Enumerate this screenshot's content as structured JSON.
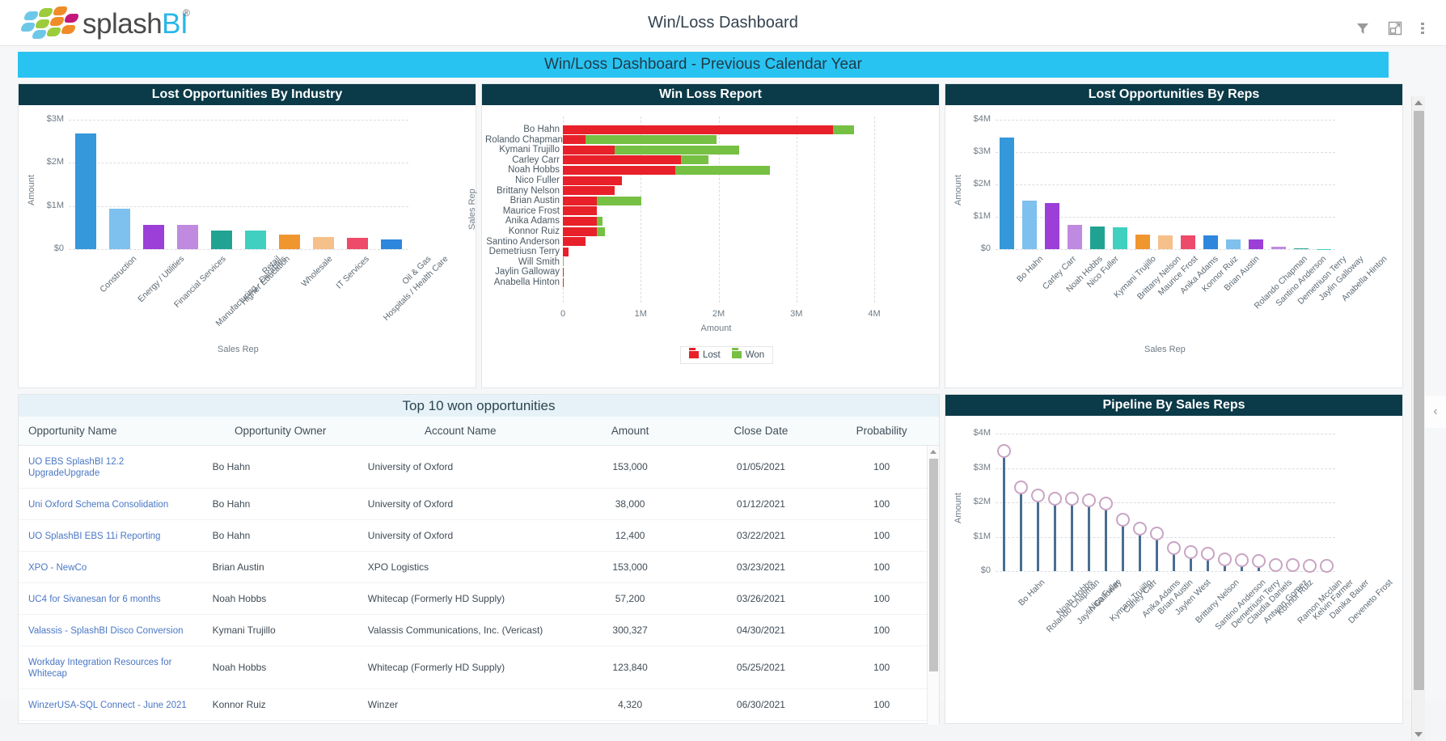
{
  "app": {
    "brand_main": "splash",
    "brand_accent": "BI",
    "brand_reg": "®",
    "title": "Win/Loss Dashboard",
    "header_icons": [
      "filter-icon",
      "expand-icon",
      "more-vertical-icon"
    ]
  },
  "banner": {
    "text": "Win/Loss Dashboard - Previous Calendar Year",
    "color": "#29c3f2"
  },
  "colors": {
    "panel_header": "#0b3a48",
    "lost": "#e8202a",
    "won": "#76c043",
    "link": "#4a77c4",
    "lolli_ring": "#c9a5c4",
    "lolli_stem": "#4a6e92"
  },
  "panels": {
    "lost_by_industry": "Lost Opportunities By Industry",
    "win_loss_report": "Win Loss Report",
    "lost_by_reps": "Lost Opportunities By Reps",
    "top10": "Top 10 won opportunities",
    "pipeline": "Pipeline By Sales Reps"
  },
  "chart_data": [
    {
      "id": "lost_by_industry",
      "type": "bar",
      "title": "Lost Opportunities By Industry",
      "xlabel": "Sales Rep",
      "ylabel": "Amount",
      "ylim": [
        0,
        3000000
      ],
      "yticks": [
        "$0",
        "$1M",
        "$2M",
        "$3M"
      ],
      "ytick_values": [
        0,
        1000000,
        2000000,
        3000000
      ],
      "grid": true,
      "categories": [
        "Construction",
        "Energy / Utilities",
        "Financial Services",
        "Manufacturing - Durables",
        "Higher Education",
        "Retail",
        "Wholesale",
        "IT Services",
        "Hospitals / Health Care",
        "Oil & Gas"
      ],
      "values": [
        2680000,
        930000,
        570000,
        555000,
        440000,
        440000,
        330000,
        290000,
        255000,
        225000
      ],
      "bar_colors": [
        "#3498db",
        "#7ec0ee",
        "#9b3fd8",
        "#bf8ae0",
        "#21a392",
        "#3fd0c0",
        "#f0962e",
        "#f6c08a",
        "#ee4a6a",
        "#2f86dd"
      ]
    },
    {
      "id": "win_loss_report",
      "type": "bar",
      "orientation": "horizontal",
      "stacked": true,
      "title": "Win Loss Report",
      "xlabel": "Amount",
      "ylabel": "Sales Rep",
      "xlim": [
        0,
        4000000
      ],
      "xticks": [
        "0",
        "1M",
        "2M",
        "3M",
        "4M"
      ],
      "xtick_values": [
        0,
        1000000,
        2000000,
        3000000,
        4000000
      ],
      "grid": true,
      "legend": [
        {
          "label": "Lost",
          "color": "#e8202a"
        },
        {
          "label": "Won",
          "color": "#76c043"
        }
      ],
      "categories": [
        "Bo Hahn",
        "Rolando Chapman",
        "Kymani Trujillo",
        "Carley Carr",
        "Noah Hobbs",
        "Nico Fuller",
        "Brittany Nelson",
        "Brian Austin",
        "Maurice Frost",
        "Anika Adams",
        "Konnor Ruiz",
        "Santino Anderson",
        "Demetriusn Terry",
        "Will Smith",
        "Jaylin Galloway",
        "Anabella Hinton"
      ],
      "series": [
        {
          "name": "Lost",
          "values": [
            3470000,
            290000,
            670000,
            1520000,
            1440000,
            760000,
            670000,
            440000,
            440000,
            440000,
            440000,
            290000,
            70000,
            0,
            10000,
            10000
          ]
        },
        {
          "name": "Won",
          "values": [
            270000,
            1680000,
            1600000,
            350000,
            1220000,
            0,
            0,
            570000,
            0,
            70000,
            100000,
            0,
            0,
            12000,
            0,
            0
          ]
        }
      ]
    },
    {
      "id": "lost_by_reps",
      "type": "bar",
      "title": "Lost Opportunities By Reps",
      "xlabel": "Sales Rep",
      "ylabel": "Amount",
      "ylim": [
        0,
        4000000
      ],
      "yticks": [
        "$0",
        "$1M",
        "$2M",
        "$3M",
        "$4M"
      ],
      "ytick_values": [
        0,
        1000000,
        2000000,
        3000000,
        4000000
      ],
      "grid": true,
      "categories": [
        "Bo Hahn",
        "Carley Carr",
        "Noah Hobbs",
        "Nico Fuller",
        "Kymani Trujillo",
        "Brittany Nelson",
        "Maurice Frost",
        "Anika Adams",
        "Konnor Ruiz",
        "Brian Austin",
        "Rolando Chapman",
        "Santino Anderson",
        "Demetriusn Terry",
        "Jaylin Galloway",
        "Anabella Hinton"
      ],
      "values": [
        3460000,
        1500000,
        1430000,
        760000,
        690000,
        670000,
        440000,
        430000,
        430000,
        420000,
        290000,
        290000,
        80000,
        15000,
        12000
      ],
      "bar_colors": [
        "#3498db",
        "#7ec0ee",
        "#9b3fd8",
        "#bf8ae0",
        "#21a392",
        "#3fd0c0",
        "#f0962e",
        "#f6c08a",
        "#ee4a6a",
        "#2f86dd",
        "#7ec0ee",
        "#9b3fd8",
        "#bf8ae0",
        "#21a392",
        "#3fd0c0"
      ]
    },
    {
      "id": "pipeline_by_sales_reps",
      "type": "scatter",
      "variant": "lollipop",
      "title": "Pipeline By Sales Reps",
      "xlabel": "",
      "ylabel": "Amount",
      "ylim": [
        0,
        4000000
      ],
      "yticks": [
        "$0",
        "$1M",
        "$2M",
        "$3M",
        "$4M"
      ],
      "ytick_values": [
        0,
        1000000,
        2000000,
        3000000,
        4000000
      ],
      "grid": true,
      "categories": [
        "Bo Hahn",
        "Rolando Chapman",
        "Noah Hobbs",
        "Jaylin Galloway",
        "Nico Fuller",
        "Kymani Trujillo",
        "Carley Carr",
        "Anika Adams",
        "Brian Austin",
        "Jaylen West",
        "Brittany Nelson",
        "Santino Anderson",
        "Demetriusn Terry",
        "Claudia Daniels",
        "Antwan Gomez",
        "Konnor Ruiz",
        "Ramon Mcclain",
        "Kelvin Farmer",
        "Danika Bauer",
        "Deveneto Frost"
      ],
      "values": [
        3400000,
        2320000,
        2100000,
        1990000,
        2000000,
        1950000,
        1850000,
        1400000,
        1140000,
        980000,
        560000,
        450000,
        400000,
        230000,
        210000,
        190000,
        70000,
        60000,
        55000,
        50000
      ]
    }
  ],
  "table": {
    "title": "Top 10 won opportunities",
    "columns": [
      "Opportunity Name",
      "Opportunity Owner",
      "Account Name",
      "Amount",
      "Close Date",
      "Probability"
    ],
    "rows": [
      {
        "name": "UO EBS SplashBI 12.2 UpgradeUpgrade",
        "owner": "Bo Hahn",
        "account": "University of Oxford",
        "amount": "153,000",
        "close": "01/05/2021",
        "prob": "100"
      },
      {
        "name": "Uni Oxford Schema Consolidation",
        "owner": "Bo Hahn",
        "account": "University of Oxford",
        "amount": "38,000",
        "close": "01/12/2021",
        "prob": "100"
      },
      {
        "name": "UO SplashBI EBS 11i Reporting",
        "owner": "Bo Hahn",
        "account": "University of Oxford",
        "amount": "12,400",
        "close": "03/22/2021",
        "prob": "100"
      },
      {
        "name": "XPO - NewCo",
        "owner": "Brian Austin",
        "account": "XPO Logistics",
        "amount": "153,000",
        "close": "03/23/2021",
        "prob": "100"
      },
      {
        "name": "UC4 for Sivanesan for 6 months",
        "owner": "Noah Hobbs",
        "account": "Whitecap (Formerly HD Supply)",
        "amount": "57,200",
        "close": "03/26/2021",
        "prob": "100"
      },
      {
        "name": "Valassis - SplashBI Disco Conversion",
        "owner": "Kymani Trujillo",
        "account": "Valassis Communications, Inc. (Vericast)",
        "amount": "300,327",
        "close": "04/30/2021",
        "prob": "100"
      },
      {
        "name": "Workday Integration Resources for Whitecap",
        "owner": "Noah Hobbs",
        "account": "Whitecap (Formerly HD Supply)",
        "amount": "123,840",
        "close": "05/25/2021",
        "prob": "100"
      },
      {
        "name": "WinzerUSA-SQL Connect - June 2021",
        "owner": "Konnor Ruiz",
        "account": "Winzer",
        "amount": "4,320",
        "close": "06/30/2021",
        "prob": "100"
      }
    ]
  }
}
